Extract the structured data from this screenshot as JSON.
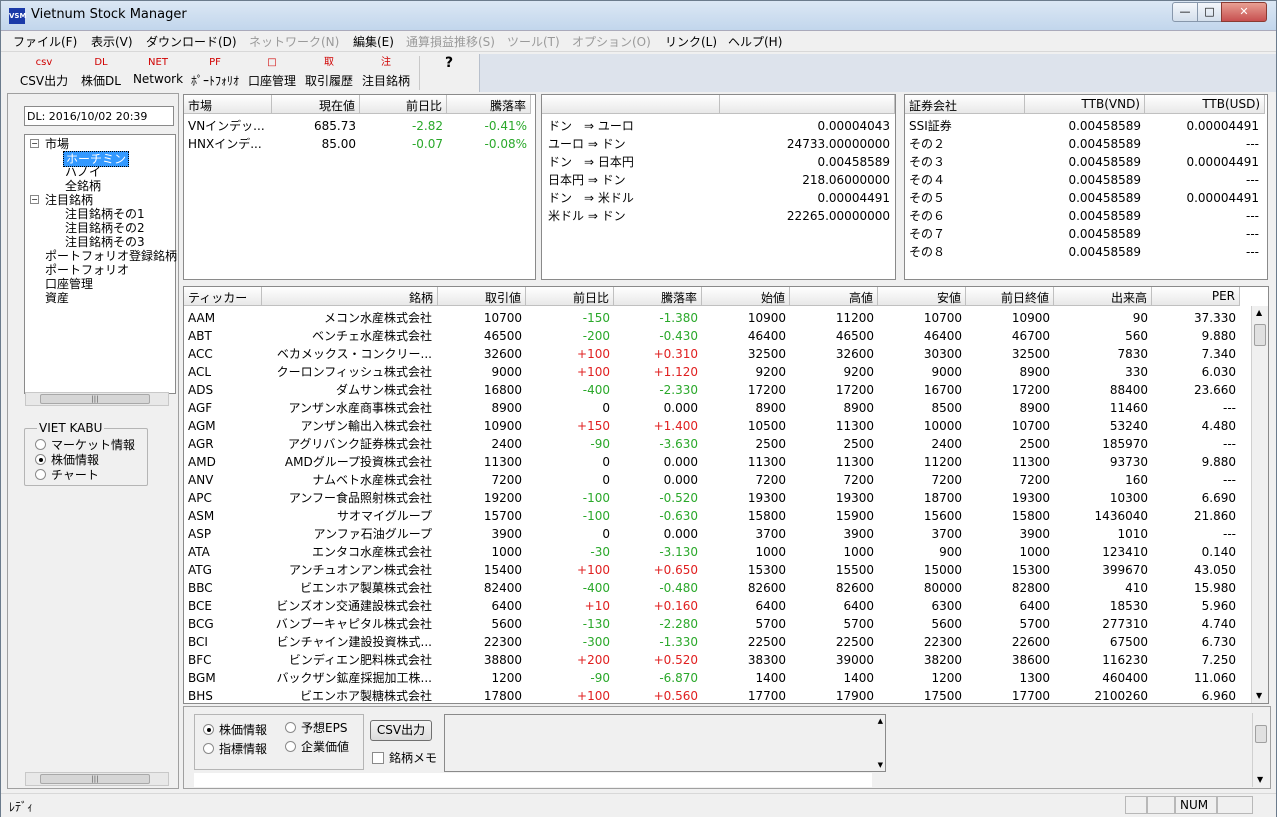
{
  "window": {
    "title": "Vietnum Stock Manager",
    "icon_text": "VSM",
    "min": "—",
    "max": "□",
    "close": "✕"
  },
  "menu": [
    {
      "label": "ファイル(F)",
      "enabled": true
    },
    {
      "label": "表示(V)",
      "enabled": true
    },
    {
      "label": "ダウンロード(D)",
      "enabled": true
    },
    {
      "label": "ネットワーク(N)",
      "enabled": false
    },
    {
      "label": "編集(E)",
      "enabled": true
    },
    {
      "label": "通算損益推移(S)",
      "enabled": false
    },
    {
      "label": "ツール(T)",
      "enabled": false
    },
    {
      "label": "オプション(O)",
      "enabled": false
    },
    {
      "label": "リンク(L)",
      "enabled": true
    },
    {
      "label": "ヘルプ(H)",
      "enabled": true
    }
  ],
  "toolbar": [
    {
      "icon": "csv",
      "label": "CSV出力"
    },
    {
      "icon": "DL",
      "label": "株価DL"
    },
    {
      "icon": "NET",
      "label": "Network"
    },
    {
      "icon": "PF",
      "label": "ﾎﾟｰﾄﾌｫﾘｵ"
    },
    {
      "icon": "□",
      "label": "口座管理"
    },
    {
      "icon": "取",
      "label": "取引履歴"
    },
    {
      "icon": "注",
      "label": "注目銘柄"
    },
    {
      "icon": "?",
      "label": ""
    }
  ],
  "left": {
    "date": "DL: 2016/10/02 20:39",
    "tree": [
      {
        "label": "市場",
        "level": 0,
        "box": "−"
      },
      {
        "label": "ホーチミン",
        "level": 1,
        "selected": true
      },
      {
        "label": "ハノイ",
        "level": 1
      },
      {
        "label": "全銘柄",
        "level": 1
      },
      {
        "label": "注目銘柄",
        "level": 0,
        "box": "−"
      },
      {
        "label": "注目銘柄その1",
        "level": 1
      },
      {
        "label": "注目銘柄その2",
        "level": 1
      },
      {
        "label": "注目銘柄その3",
        "level": 1
      },
      {
        "label": "ポートフォリオ登録銘柄",
        "level": 0
      },
      {
        "label": "ポートフォリオ",
        "level": 0
      },
      {
        "label": "口座管理",
        "level": 0
      },
      {
        "label": "資産",
        "level": 0
      }
    ],
    "group_title": "VIET KABU",
    "options": [
      {
        "label": "マーケット情報",
        "checked": false
      },
      {
        "label": "株価情報",
        "checked": true
      },
      {
        "label": "チャート",
        "checked": false
      }
    ]
  },
  "market": {
    "headers": [
      "市場",
      "現在値",
      "前日比",
      "騰落率"
    ],
    "rows": [
      [
        "VNインデッ...",
        "685.73",
        "-2.82",
        "-0.41%"
      ],
      [
        "HNXインデ...",
        "85.00",
        "-0.07",
        "-0.08%"
      ]
    ]
  },
  "fx": {
    "rows": [
      [
        "ドン　⇒ ユーロ",
        "0.00004043"
      ],
      [
        "ユーロ ⇒ ドン",
        "24733.00000000"
      ],
      [
        "ドン　⇒ 日本円",
        "0.00458589"
      ],
      [
        "日本円 ⇒ ドン",
        "218.06000000"
      ],
      [
        "ドン　⇒ 米ドル",
        "0.00004491"
      ],
      [
        "米ドル ⇒ ドン",
        "22265.00000000"
      ]
    ]
  },
  "brokers": {
    "headers": [
      "証券会社",
      "TTB(VND)",
      "TTB(USD)"
    ],
    "rows": [
      [
        "SSI証券",
        "0.00458589",
        "0.00004491"
      ],
      [
        "その２",
        "0.00458589",
        "---"
      ],
      [
        "その３",
        "0.00458589",
        "0.00004491"
      ],
      [
        "その４",
        "0.00458589",
        "---"
      ],
      [
        "その５",
        "0.00458589",
        "0.00004491"
      ],
      [
        "その６",
        "0.00458589",
        "---"
      ],
      [
        "その７",
        "0.00458589",
        "---"
      ],
      [
        "その８",
        "0.00458589",
        "---"
      ]
    ]
  },
  "stocks": {
    "headers": [
      "ティッカー",
      "銘柄",
      "取引値",
      "前日比",
      "騰落率",
      "始値",
      "高値",
      "安値",
      "前日終値",
      "出来高",
      "PER"
    ],
    "rows": [
      [
        "AAM",
        "メコン水産株式会社",
        "10700",
        "-150",
        "-1.380",
        "10900",
        "11200",
        "10700",
        "10900",
        "90",
        "37.330"
      ],
      [
        "ABT",
        "ベンチェ水産株式会社",
        "46500",
        "-200",
        "-0.430",
        "46400",
        "46500",
        "46400",
        "46700",
        "560",
        "9.880"
      ],
      [
        "ACC",
        "ベカメックス・コンクリー...",
        "32600",
        "+100",
        "+0.310",
        "32500",
        "32600",
        "30300",
        "32500",
        "7830",
        "7.340"
      ],
      [
        "ACL",
        "クーロンフィッシュ株式会社",
        "9000",
        "+100",
        "+1.120",
        "9200",
        "9200",
        "9000",
        "8900",
        "330",
        "6.030"
      ],
      [
        "ADS",
        "ダムサン株式会社",
        "16800",
        "-400",
        "-2.330",
        "17200",
        "17200",
        "16700",
        "17200",
        "88400",
        "23.660"
      ],
      [
        "AGF",
        "アンザン水産商事株式会社",
        "8900",
        "0",
        "0.000",
        "8900",
        "8900",
        "8500",
        "8900",
        "11460",
        "---"
      ],
      [
        "AGM",
        "アンザン輸出入株式会社",
        "10900",
        "+150",
        "+1.400",
        "10500",
        "11300",
        "10000",
        "10700",
        "53240",
        "4.480"
      ],
      [
        "AGR",
        "アグリバンク証券株式会社",
        "2400",
        "-90",
        "-3.630",
        "2500",
        "2500",
        "2400",
        "2500",
        "185970",
        "---"
      ],
      [
        "AMD",
        "AMDグループ投資株式会社",
        "11300",
        "0",
        "0.000",
        "11300",
        "11300",
        "11200",
        "11300",
        "93730",
        "9.880"
      ],
      [
        "ANV",
        "ナムベト水産株式会社",
        "7200",
        "0",
        "0.000",
        "7200",
        "7200",
        "7200",
        "7200",
        "160",
        "---"
      ],
      [
        "APC",
        "アンフー食品照射株式会社",
        "19200",
        "-100",
        "-0.520",
        "19300",
        "19300",
        "18700",
        "19300",
        "10300",
        "6.690"
      ],
      [
        "ASM",
        "サオマイグループ",
        "15700",
        "-100",
        "-0.630",
        "15800",
        "15900",
        "15600",
        "15800",
        "1436040",
        "21.860"
      ],
      [
        "ASP",
        "アンファ石油グループ",
        "3900",
        "0",
        "0.000",
        "3700",
        "3900",
        "3700",
        "3900",
        "1010",
        "---"
      ],
      [
        "ATA",
        "エンタコ水産株式会社",
        "1000",
        "-30",
        "-3.130",
        "1000",
        "1000",
        "900",
        "1000",
        "123410",
        "0.140"
      ],
      [
        "ATG",
        "アンチュオンアン株式会社",
        "15400",
        "+100",
        "+0.650",
        "15300",
        "15500",
        "15000",
        "15300",
        "399670",
        "43.050"
      ],
      [
        "BBC",
        "ビエンホア製菓株式会社",
        "82400",
        "-400",
        "-0.480",
        "82600",
        "82600",
        "80000",
        "82800",
        "410",
        "15.980"
      ],
      [
        "BCE",
        "ビンズオン交通建設株式会社",
        "6400",
        "+10",
        "+0.160",
        "6400",
        "6400",
        "6300",
        "6400",
        "18530",
        "5.960"
      ],
      [
        "BCG",
        "バンブーキャピタル株式会社",
        "5600",
        "-130",
        "-2.280",
        "5700",
        "5700",
        "5600",
        "5700",
        "277310",
        "4.740"
      ],
      [
        "BCI",
        "ビンチャイン建設投資株式...",
        "22300",
        "-300",
        "-1.330",
        "22500",
        "22500",
        "22300",
        "22600",
        "67500",
        "6.730"
      ],
      [
        "BFC",
        "ビンディエン肥料株式会社",
        "38800",
        "+200",
        "+0.520",
        "38300",
        "39000",
        "38200",
        "38600",
        "116230",
        "7.250"
      ],
      [
        "BGM",
        "バックザン鉱産採掘加工株...",
        "1200",
        "-90",
        "-6.870",
        "1400",
        "1400",
        "1200",
        "1300",
        "460400",
        "11.060"
      ],
      [
        "BHS",
        "ビエンホア製糖株式会社",
        "17800",
        "+100",
        "+0.560",
        "17700",
        "17900",
        "17500",
        "17700",
        "2100260",
        "6.960"
      ]
    ]
  },
  "bottom": {
    "options": [
      {
        "label": "株価情報",
        "checked": true
      },
      {
        "label": "予想EPS",
        "checked": false
      },
      {
        "label": "指標情報",
        "checked": false
      },
      {
        "label": "企業価値",
        "checked": false
      }
    ],
    "csv_button": "CSV出力",
    "memo_checkbox": "銘柄メモ"
  },
  "status": {
    "text": "ﾚﾃﾞｨ",
    "num": "NUM"
  },
  "colors": {
    "negative": "#2aa82a",
    "positive": "#e02020",
    "selection": "#3399ff"
  }
}
